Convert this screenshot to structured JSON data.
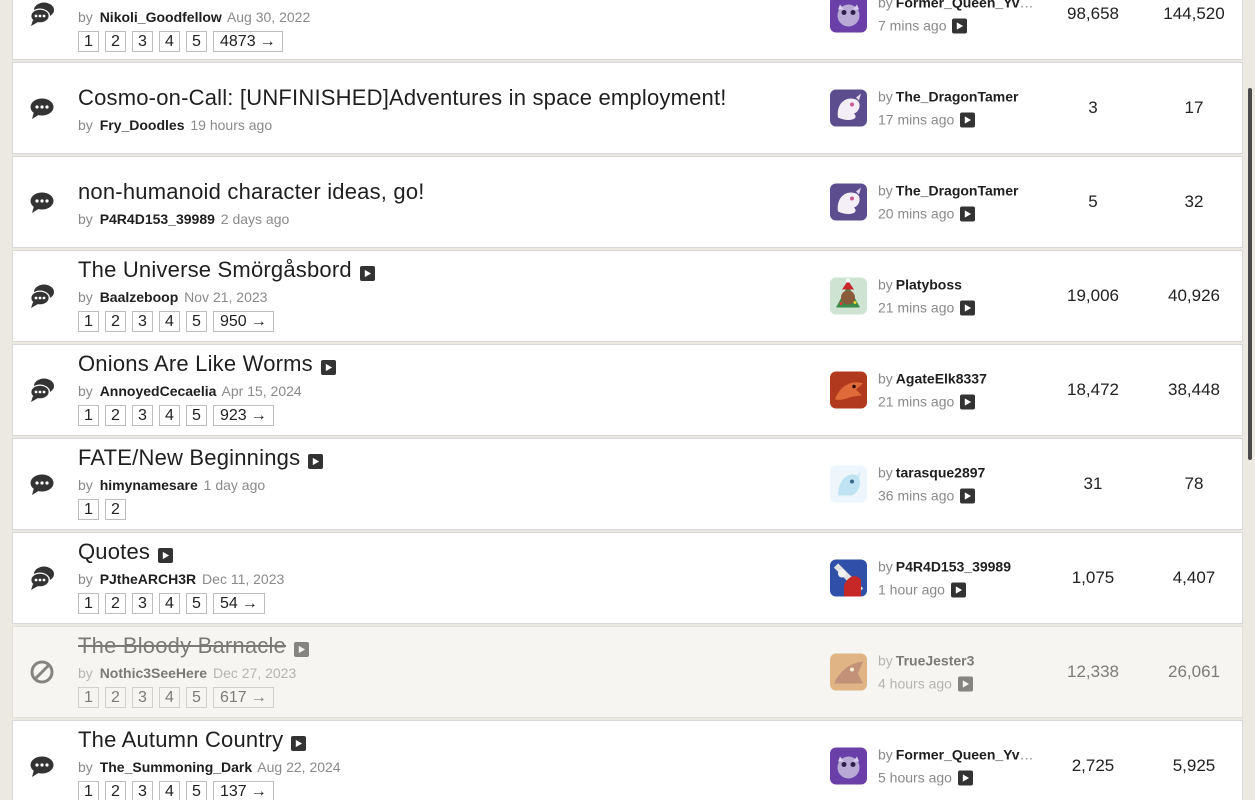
{
  "threads": [
    {
      "icon": "multi-chat-icon",
      "title": "",
      "has_title": false,
      "author": "Nikoli_Goodfellow",
      "date": "Aug 30, 2022",
      "pages": [
        "1",
        "2",
        "3",
        "4",
        "5"
      ],
      "last_page": "4873",
      "last_user": "Former_Queen_Yvo...",
      "last_time": "7 mins ago",
      "replies": "98,658",
      "views": "144,520",
      "avatar": "purple",
      "locked": false
    },
    {
      "icon": "chat-icon",
      "title": "Cosmo-on-Call: [UNFINISHED]Adventures in space employment!",
      "has_title": true,
      "author": "Fry_Doodles",
      "date": "19 hours ago",
      "pages": [],
      "last_page": "",
      "last_user": "The_DragonTamer",
      "last_time": "17 mins ago",
      "replies": "3",
      "views": "17",
      "avatar": "white-dragon",
      "locked": false
    },
    {
      "icon": "chat-icon",
      "title": "non-humanoid character ideas, go!",
      "has_title": true,
      "author": "P4R4D153_39989",
      "date": "2 days ago",
      "pages": [],
      "last_page": "",
      "last_user": "The_DragonTamer",
      "last_time": "20 mins ago",
      "replies": "5",
      "views": "32",
      "avatar": "white-dragon",
      "locked": false
    },
    {
      "icon": "multi-chat-icon",
      "title": "The Universe Smörgåsbord",
      "has_title": true,
      "author": "Baalzeboop",
      "date": "Nov 21, 2023",
      "pages": [
        "1",
        "2",
        "3",
        "4",
        "5"
      ],
      "last_page": "950",
      "last_user": "Platyboss",
      "last_time": "21 mins ago",
      "replies": "19,006",
      "views": "40,926",
      "avatar": "green-holiday",
      "locked": false
    },
    {
      "icon": "multi-chat-icon",
      "title": "Onions Are Like Worms",
      "has_title": true,
      "author": "AnnoyedCecaelia",
      "date": "Apr 15, 2024",
      "pages": [
        "1",
        "2",
        "3",
        "4",
        "5"
      ],
      "last_page": "923",
      "last_user": "AgateElk8337",
      "last_time": "21 mins ago",
      "replies": "18,472",
      "views": "38,448",
      "avatar": "red-dragon",
      "locked": false
    },
    {
      "icon": "chat-icon",
      "title": "FATE/New Beginnings",
      "has_title": true,
      "author": "himynamesare",
      "date": "1 day ago",
      "pages": [
        "1",
        "2"
      ],
      "last_page": "",
      "last_user": "tarasque2897",
      "last_time": "36 mins ago",
      "replies": "31",
      "views": "78",
      "avatar": "pale-blue",
      "locked": false
    },
    {
      "icon": "multi-chat-icon",
      "title": "Quotes",
      "has_title": true,
      "author": "PJtheARCH3R",
      "date": "Dec 11, 2023",
      "pages": [
        "1",
        "2",
        "3",
        "4",
        "5"
      ],
      "last_page": "54",
      "last_user": "P4R4D153_39989",
      "last_time": "1 hour ago",
      "replies": "1,075",
      "views": "4,407",
      "avatar": "blue-red",
      "locked": false
    },
    {
      "icon": "blocked-icon",
      "title": "The Bloody Barnacle",
      "has_title": true,
      "author": "Nothic3SeeHere",
      "date": "Dec 27, 2023",
      "pages": [
        "1",
        "2",
        "3",
        "4",
        "5"
      ],
      "last_page": "617",
      "last_user": "TrueJester3",
      "last_time": "4 hours ago",
      "replies": "12,338",
      "views": "26,061",
      "avatar": "orange",
      "locked": true
    },
    {
      "icon": "chat-icon",
      "title": "The Autumn Country",
      "has_title": true,
      "author": "The_Summoning_Dark",
      "date": "Aug 22, 2024",
      "pages": [
        "1",
        "2",
        "3",
        "4",
        "5"
      ],
      "last_page": "137",
      "last_user": "Former_Queen_Yvo...",
      "last_time": "5 hours ago",
      "replies": "2,725",
      "views": "5,925",
      "avatar": "purple",
      "locked": false
    }
  ],
  "labels": {
    "by": "by",
    "arrow": "→"
  }
}
